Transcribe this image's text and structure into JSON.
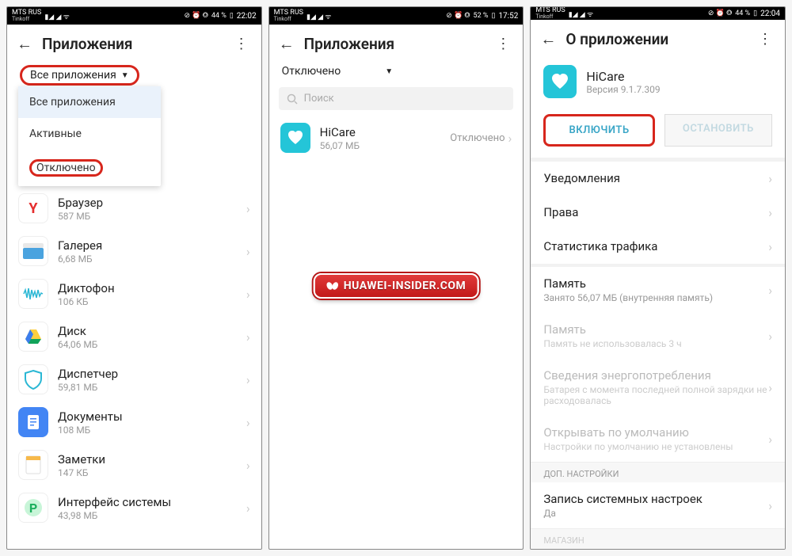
{
  "watermark": "HUAWEI-INSIDER.COM",
  "screen1": {
    "status": {
      "carrier1": "MTS RUS",
      "carrier2": "Tinkoff",
      "battery": "44 %",
      "time": "22:02",
      "signal_icons": "▮◢ ◢ ᯤ",
      "right_icons": "⊘ ⏰ ⭗"
    },
    "header": {
      "title": "Приложения"
    },
    "filter_label": "Все приложения",
    "dropdown": {
      "items": [
        "Все приложения",
        "Активные",
        "Отключено"
      ]
    },
    "apps": [
      {
        "name": "Браузер",
        "size": "587 МБ",
        "icon": "Y",
        "iconBg": "#fff",
        "iconColor": "#e52e2e"
      },
      {
        "name": "Галерея",
        "size": "6,68 МБ",
        "icon": "gallery",
        "iconBg": "#fff"
      },
      {
        "name": "Диктофон",
        "size": "106 КБ",
        "icon": "wave",
        "iconBg": "#fff"
      },
      {
        "name": "Диск",
        "size": "64,06 МБ",
        "icon": "drive",
        "iconBg": "#fff"
      },
      {
        "name": "Диспетчер",
        "size": "59,81 МБ",
        "icon": "shield",
        "iconBg": "#fff"
      },
      {
        "name": "Документы",
        "size": "108 МБ",
        "icon": "doc",
        "iconBg": "#4285f4"
      },
      {
        "name": "Заметки",
        "size": "147 КБ",
        "icon": "note",
        "iconBg": "#fff"
      },
      {
        "name": "Интерфейс системы",
        "size": "43,98 МБ",
        "icon": "p",
        "iconBg": "#fff"
      }
    ]
  },
  "screen2": {
    "status": {
      "carrier1": "MTS RUS",
      "carrier2": "Tinkoff",
      "battery": "52 %",
      "time": "17:52",
      "signal_icons": "▮◢ ◢ ᯤ",
      "right_icons": "⊘ ⏰ ⭗"
    },
    "header": {
      "title": "Приложения"
    },
    "filter_label": "Отключено",
    "search_placeholder": "Поиск",
    "apps": [
      {
        "name": "HiCare",
        "size": "56,07 МБ",
        "status": "Отключено"
      }
    ]
  },
  "screen3": {
    "status": {
      "carrier1": "MTS RUS",
      "carrier2": "Tinkoff",
      "battery": "44 %",
      "time": "22:04",
      "signal_icons": "▮◢ ◢ ᯤ",
      "right_icons": "⊘ ⏰ ⭗"
    },
    "header": {
      "title": "О приложении"
    },
    "app": {
      "name": "HiCare",
      "version": "Версия 9.1.7.309"
    },
    "buttons": {
      "enable": "ВКЛЮЧИТЬ",
      "stop": "ОСТАНОВИТЬ"
    },
    "rows": {
      "notifications": "Уведомления",
      "permissions": "Права",
      "traffic": "Статистика трафика",
      "storage": "Память",
      "storage_sub": "Занято 56,07 МБ (внутренняя память)",
      "memory": "Память",
      "memory_sub": "Память не использовалась 3 ч",
      "power": "Сведения энергопотребления",
      "power_sub": "Батарея с момента последней полной зарядки не расходовалась",
      "default": "Открывать по умолчанию",
      "default_sub": "Настройки по умолчанию не установлены",
      "extra_label": "ДОП. НАСТРОЙКИ",
      "system": "Запись системных настроек",
      "system_val": "Да",
      "store_label": "МАГАЗИН"
    }
  }
}
